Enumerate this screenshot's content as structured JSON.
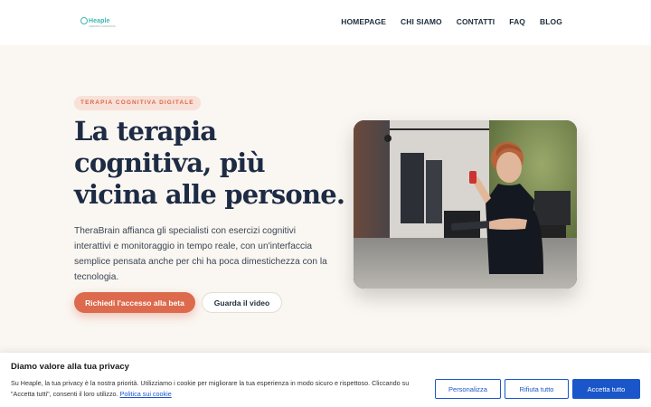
{
  "header": {
    "logo_text": "Heaple",
    "logo_sub": "TERAPIA COGNITIVA",
    "nav": [
      "HOMEPAGE",
      "CHI SIAMO",
      "CONTATTI",
      "FAQ",
      "BLOG"
    ]
  },
  "hero": {
    "badge": "TERAPIA COGNITIVA DIGITALE",
    "title_lines": [
      "La terapia",
      "cognitiva, più",
      "vicina alle persone."
    ],
    "description": "TheraBrain affianca gli specialisti con esercizi cognitivi interattivi e monitoraggio in tempo reale, con un'interfaccia semplice pensata anche per chi ha poca dimestichezza con la tecnologia.",
    "primary_button": "Richiedi l'accesso alla beta",
    "secondary_button": "Guarda il video",
    "accent_color": "#dd6a4d",
    "title_color": "#1d2b44"
  },
  "cookie_banner": {
    "title": "Diamo valore alla tua privacy",
    "text": "Su Heaple, la tua privacy è la nostra priorità. Utilizziamo i cookie per migliorare la tua esperienza in modo sicuro e rispettoso. Cliccando su \"Accetta tutti\", consenti il loro utilizzo.",
    "policy_link": "Politica sui cookie",
    "buttons": {
      "customize": "Personalizza",
      "reject": "Rifiuta tutto",
      "accept": "Accetta tutto"
    },
    "button_color": "#1a56c9"
  }
}
